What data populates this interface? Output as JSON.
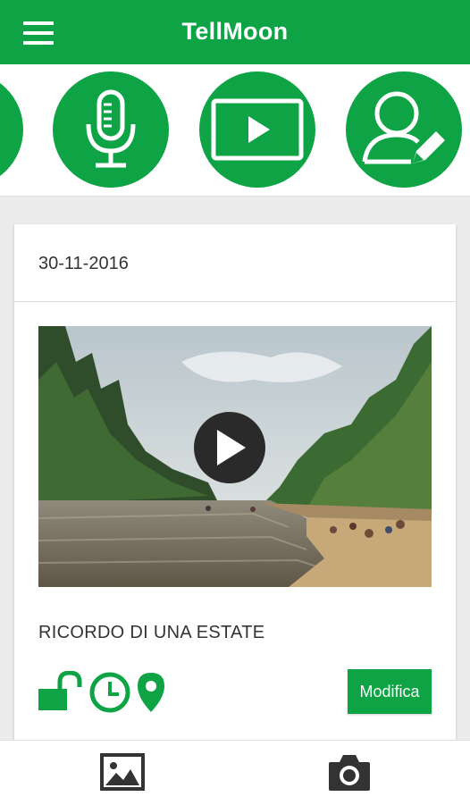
{
  "header": {
    "title": "TellMoon",
    "menu_icon": "hamburger-menu-icon"
  },
  "action_strip": {
    "items": [
      {
        "icon": "partial-circle-icon"
      },
      {
        "icon": "microphone-icon"
      },
      {
        "icon": "video-play-icon"
      },
      {
        "icon": "edit-profile-icon"
      }
    ]
  },
  "card": {
    "date": "30-11-2016",
    "media_type": "video",
    "title": "RICORDO DI UNA ESTATE",
    "status_icons": [
      "unlocked-padlock-icon",
      "clock-icon",
      "location-pin-icon"
    ],
    "edit_label": "Modifica"
  },
  "bottom_bar": {
    "items": [
      {
        "icon": "image-gallery-icon"
      },
      {
        "icon": "camera-icon"
      }
    ]
  },
  "colors": {
    "accent": "#0ea345",
    "background": "#ececec",
    "text": "#333333"
  }
}
